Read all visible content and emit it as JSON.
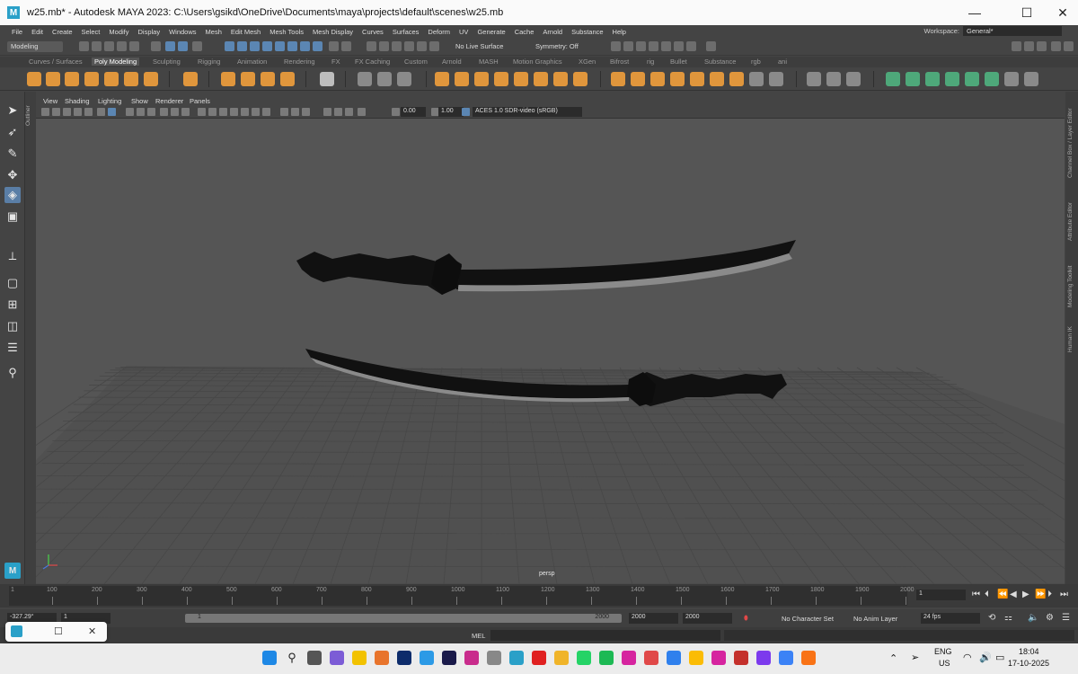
{
  "window": {
    "title": "w25.mb* - Autodesk MAYA 2023: C:\\Users\\gsikd\\OneDrive\\Documents\\maya\\projects\\default\\scenes\\w25.mb",
    "app_icon": "M",
    "minimize": "—",
    "maximize": "☐",
    "close": "✕"
  },
  "menubar": {
    "items": [
      "File",
      "Edit",
      "Create",
      "Select",
      "Modify",
      "Display",
      "Windows",
      "Mesh",
      "Edit Mesh",
      "Mesh Tools",
      "Mesh Display",
      "Curves",
      "Surfaces",
      "Deform",
      "UV",
      "Generate",
      "Cache",
      "Arnold",
      "Substance",
      "Help"
    ],
    "workspace_label": "Workspace:",
    "workspace_value": "General*"
  },
  "statusline": {
    "mode": "Modeling",
    "live_surface": "No Live Surface",
    "symmetry": "Symmetry: Off"
  },
  "shelf_tabs": [
    "Curves / Surfaces",
    "Poly Modeling",
    "Sculpting",
    "Rigging",
    "Animation",
    "Rendering",
    "FX",
    "FX Caching",
    "Custom",
    "Arnold",
    "MASH",
    "Motion Graphics",
    "XGen",
    "Bifrost",
    "rig",
    "Bullet",
    "Substance",
    "rgb",
    "ani"
  ],
  "shelf_active": "Poly Modeling",
  "panel": {
    "menus": [
      "View",
      "Shading",
      "Lighting",
      "Show",
      "Renderer",
      "Panels"
    ],
    "exposure": "0.00",
    "gamma": "1.00",
    "color_space": "ACES 1.0 SDR-video (sRGB)",
    "camera": "persp"
  },
  "side_tabs": {
    "outliner": "Outliner",
    "right": [
      "Channel Box / Layer Editor",
      "Attribute Editor",
      "Modeling Toolkit",
      "Human IK"
    ]
  },
  "timeline": {
    "start_frame": "1",
    "ticks": [
      "100",
      "200",
      "300",
      "400",
      "500",
      "600",
      "700",
      "800",
      "900",
      "1000",
      "1100",
      "1200",
      "1300",
      "1400",
      "1500",
      "1600",
      "1700",
      "1800",
      "1900",
      "2000"
    ],
    "current_frame": "1"
  },
  "range": {
    "coord_readout": "-327.29°",
    "start": "1",
    "inner_start": "1",
    "inner_end": "2000",
    "end_a": "2000",
    "end_b": "2000",
    "character_set": "No Character Set",
    "anim_layer": "No Anim Layer",
    "fps": "24 fps"
  },
  "cmdline": {
    "lang": "MEL"
  },
  "taskbar": {
    "lang_top": "ENG",
    "lang_bottom": "US",
    "time": "18:04",
    "date": "17-10-2025"
  },
  "colors": {
    "accent_blue": "#5b86b3",
    "shelf_orange": "#e0963c",
    "shelf_green": "#4ea87a",
    "viewport_bg": "#555555"
  }
}
